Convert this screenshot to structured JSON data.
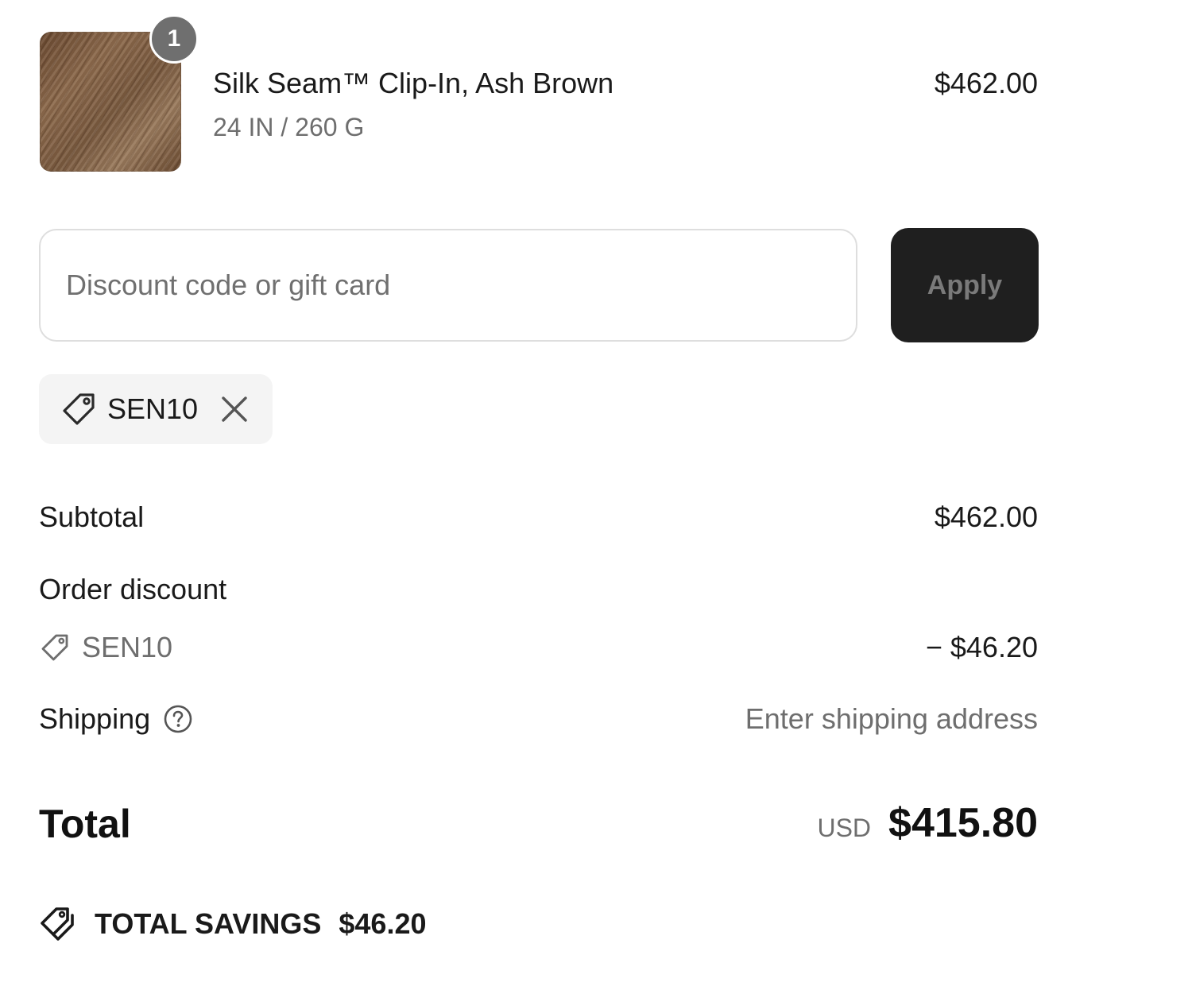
{
  "product": {
    "quantity_badge": "1",
    "name": "Silk Seam™ Clip-In, Ash Brown",
    "variant": "24 IN / 260 G",
    "price": "$462.00"
  },
  "discount": {
    "placeholder": "Discount code or gift card",
    "value": "",
    "apply_label": "Apply",
    "applied_code": "SEN10"
  },
  "summary": {
    "subtotal_label": "Subtotal",
    "subtotal_value": "$462.00",
    "order_discount_label": "Order discount",
    "order_discount_code": "SEN10",
    "order_discount_value": "− $46.20",
    "shipping_label": "Shipping",
    "shipping_value": "Enter shipping address",
    "total_label": "Total",
    "currency": "USD",
    "total_value": "$415.80",
    "savings_label": "TOTAL SAVINGS",
    "savings_value": "$46.20"
  },
  "icons": {
    "tag": "tag-icon",
    "close": "close-icon",
    "help": "help-circle-icon",
    "savings": "double-tag-icon"
  },
  "colors": {
    "apply_button_bg": "#1f1f1f",
    "badge_bg": "#6f6f6f",
    "chip_bg": "#f4f4f4",
    "muted_text": "#6e6e6e"
  }
}
